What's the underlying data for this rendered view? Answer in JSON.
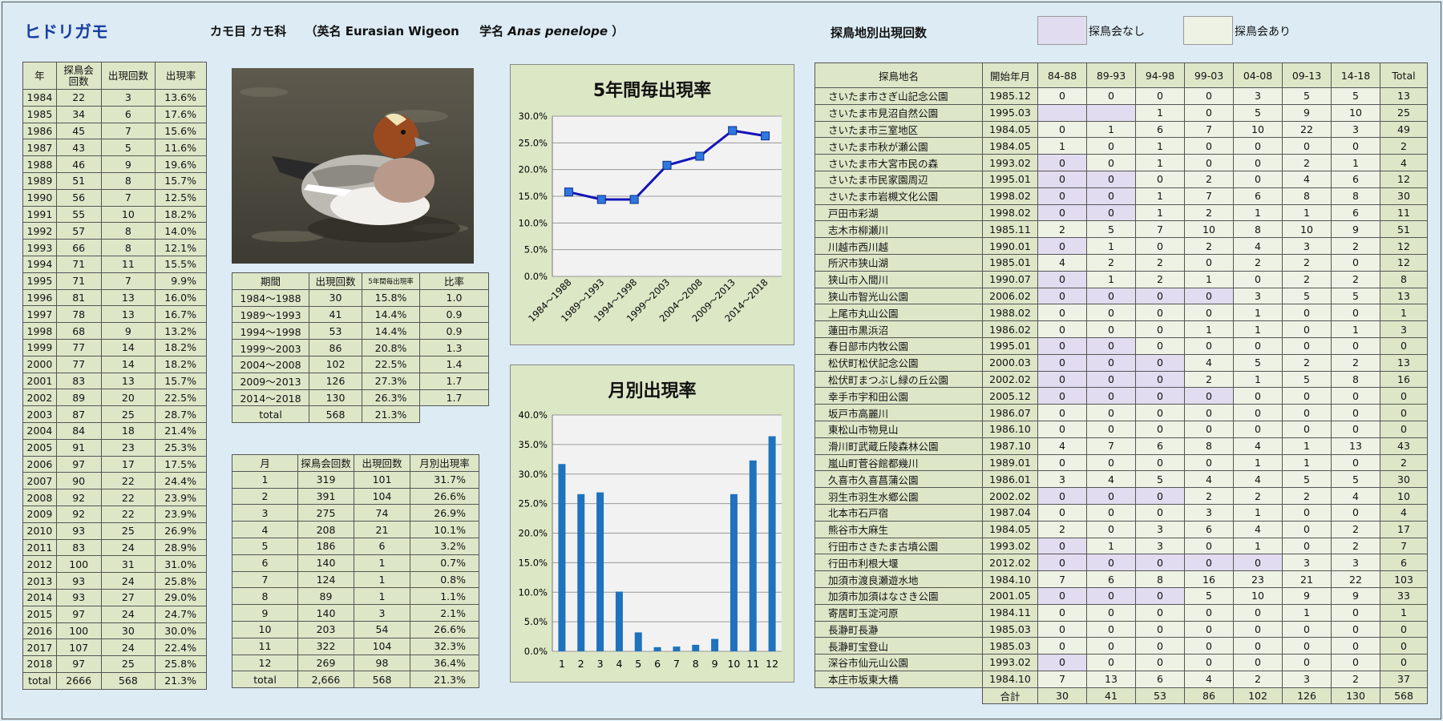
{
  "header": {
    "title": "ヒドリガモ",
    "taxonomy": "カモ目 カモ科",
    "english_label": "（英名",
    "english_name": "Eurasian Wigeon",
    "scientific_label": "学名",
    "scientific_name": "Anas penelope",
    "close_paren": "）",
    "sites_title": "探鳥地別出現回数",
    "legend_no_meeting": "探鳥会なし",
    "legend_with_meeting": "探鳥会あり"
  },
  "colors": {
    "no_meeting": "#e2dcf0",
    "with_meeting": "#eef2e4",
    "header_green": "#dde7c8",
    "line": "#1414b8",
    "bar": "#1f72bc"
  },
  "yearly": {
    "headers": [
      "年",
      "探鳥会回数",
      "出現回数",
      "出現率"
    ],
    "rows": [
      [
        "1984",
        "22",
        "3",
        "13.6%"
      ],
      [
        "1985",
        "34",
        "6",
        "17.6%"
      ],
      [
        "1986",
        "45",
        "7",
        "15.6%"
      ],
      [
        "1987",
        "43",
        "5",
        "11.6%"
      ],
      [
        "1988",
        "46",
        "9",
        "19.6%"
      ],
      [
        "1989",
        "51",
        "8",
        "15.7%"
      ],
      [
        "1990",
        "56",
        "7",
        "12.5%"
      ],
      [
        "1991",
        "55",
        "10",
        "18.2%"
      ],
      [
        "1992",
        "57",
        "8",
        "14.0%"
      ],
      [
        "1993",
        "66",
        "8",
        "12.1%"
      ],
      [
        "1994",
        "71",
        "11",
        "15.5%"
      ],
      [
        "1995",
        "71",
        "7",
        "9.9%"
      ],
      [
        "1996",
        "81",
        "13",
        "16.0%"
      ],
      [
        "1997",
        "78",
        "13",
        "16.7%"
      ],
      [
        "1998",
        "68",
        "9",
        "13.2%"
      ],
      [
        "1999",
        "77",
        "14",
        "18.2%"
      ],
      [
        "2000",
        "77",
        "14",
        "18.2%"
      ],
      [
        "2001",
        "83",
        "13",
        "15.7%"
      ],
      [
        "2002",
        "89",
        "20",
        "22.5%"
      ],
      [
        "2003",
        "87",
        "25",
        "28.7%"
      ],
      [
        "2004",
        "84",
        "18",
        "21.4%"
      ],
      [
        "2005",
        "91",
        "23",
        "25.3%"
      ],
      [
        "2006",
        "97",
        "17",
        "17.5%"
      ],
      [
        "2007",
        "90",
        "22",
        "24.4%"
      ],
      [
        "2008",
        "92",
        "22",
        "23.9%"
      ],
      [
        "2009",
        "92",
        "22",
        "23.9%"
      ],
      [
        "2010",
        "93",
        "25",
        "26.9%"
      ],
      [
        "2011",
        "83",
        "24",
        "28.9%"
      ],
      [
        "2012",
        "100",
        "31",
        "31.0%"
      ],
      [
        "2013",
        "93",
        "24",
        "25.8%"
      ],
      [
        "2014",
        "93",
        "27",
        "29.0%"
      ],
      [
        "2015",
        "97",
        "24",
        "24.7%"
      ],
      [
        "2016",
        "100",
        "30",
        "30.0%"
      ],
      [
        "2017",
        "107",
        "24",
        "22.4%"
      ],
      [
        "2018",
        "97",
        "25",
        "25.8%"
      ],
      [
        "total",
        "2666",
        "568",
        "21.3%"
      ]
    ]
  },
  "period": {
    "headers": [
      "期間",
      "出現回数",
      "5年間毎出現率",
      "比率"
    ],
    "rows": [
      [
        "1984～1988",
        "30",
        "15.8%",
        "1.0"
      ],
      [
        "1989～1993",
        "41",
        "14.4%",
        "0.9"
      ],
      [
        "1994～1998",
        "53",
        "14.4%",
        "0.9"
      ],
      [
        "1999～2003",
        "86",
        "20.8%",
        "1.3"
      ],
      [
        "2004～2008",
        "102",
        "22.5%",
        "1.4"
      ],
      [
        "2009～2013",
        "126",
        "27.3%",
        "1.7"
      ],
      [
        "2014～2018",
        "130",
        "26.3%",
        "1.7"
      ]
    ],
    "total": [
      "total",
      "568",
      "21.3%"
    ]
  },
  "monthly": {
    "headers": [
      "月",
      "探鳥会回数",
      "出現回数",
      "月別出現率"
    ],
    "rows": [
      [
        "1",
        "319",
        "101",
        "31.7%"
      ],
      [
        "2",
        "391",
        "104",
        "26.6%"
      ],
      [
        "3",
        "275",
        "74",
        "26.9%"
      ],
      [
        "4",
        "208",
        "21",
        "10.1%"
      ],
      [
        "5",
        "186",
        "6",
        "3.2%"
      ],
      [
        "6",
        "140",
        "1",
        "0.7%"
      ],
      [
        "7",
        "124",
        "1",
        "0.8%"
      ],
      [
        "8",
        "89",
        "1",
        "1.1%"
      ],
      [
        "9",
        "140",
        "3",
        "2.1%"
      ],
      [
        "10",
        "203",
        "54",
        "26.6%"
      ],
      [
        "11",
        "322",
        "104",
        "32.3%"
      ],
      [
        "12",
        "269",
        "98",
        "36.4%"
      ],
      [
        "total",
        "2,666",
        "568",
        "21.3%"
      ]
    ]
  },
  "chart_data": [
    {
      "type": "line",
      "title": "5年間毎出現率",
      "categories": [
        "1984～1988",
        "1989～1993",
        "1994～1998",
        "1999～2003",
        "2004～2008",
        "2009～2013",
        "2014～2018"
      ],
      "values": [
        15.8,
        14.4,
        14.4,
        20.8,
        22.5,
        27.3,
        26.3
      ],
      "y_ticks": [
        "0.0%",
        "5.0%",
        "10.0%",
        "15.0%",
        "20.0%",
        "25.0%",
        "30.0%"
      ],
      "ylim": [
        0,
        30
      ],
      "grid": true
    },
    {
      "type": "bar",
      "title": "月別出現率",
      "categories": [
        "1",
        "2",
        "3",
        "4",
        "5",
        "6",
        "7",
        "8",
        "9",
        "10",
        "11",
        "12"
      ],
      "values": [
        31.7,
        26.6,
        26.9,
        10.1,
        3.2,
        0.7,
        0.8,
        1.1,
        2.1,
        26.6,
        32.3,
        36.4
      ],
      "y_ticks": [
        "0.0%",
        "5.0%",
        "10.0%",
        "15.0%",
        "20.0%",
        "25.0%",
        "30.0%",
        "35.0%",
        "40.0%"
      ],
      "ylim": [
        0,
        40
      ],
      "grid": true
    }
  ],
  "sites": {
    "headers": [
      "探鳥地名",
      "開始年月",
      "84-88",
      "89-93",
      "94-98",
      "99-03",
      "04-08",
      "09-13",
      "14-18",
      "Total"
    ],
    "rows": [
      {
        "name": "さいたま市さぎ山記念公園",
        "start": "1985.12",
        "v": [
          "0",
          "0",
          "0",
          "0",
          "3",
          "5",
          "5",
          "13"
        ],
        "lav": []
      },
      {
        "name": "さいたま市見沼自然公園",
        "start": "1995.03",
        "v": [
          "",
          "",
          "1",
          "0",
          "5",
          "9",
          "10",
          "25"
        ],
        "lav": [
          0,
          1
        ]
      },
      {
        "name": "さいたま市三室地区",
        "start": "1984.05",
        "v": [
          "0",
          "1",
          "6",
          "7",
          "10",
          "22",
          "3",
          "49"
        ],
        "lav": []
      },
      {
        "name": "さいたま市秋が瀬公園",
        "start": "1984.05",
        "v": [
          "1",
          "0",
          "1",
          "0",
          "0",
          "0",
          "0",
          "2"
        ],
        "lav": []
      },
      {
        "name": "さいたま市大宮市民の森",
        "start": "1993.02",
        "v": [
          "0",
          "0",
          "1",
          "0",
          "0",
          "2",
          "1",
          "4"
        ],
        "lav": [
          0
        ]
      },
      {
        "name": "さいたま市民家園周辺",
        "start": "1995.01",
        "v": [
          "0",
          "0",
          "0",
          "2",
          "0",
          "4",
          "6",
          "12"
        ],
        "lav": [
          0,
          1
        ]
      },
      {
        "name": "さいたま市岩槻文化公園",
        "start": "1998.02",
        "v": [
          "0",
          "0",
          "1",
          "7",
          "6",
          "8",
          "8",
          "30"
        ],
        "lav": [
          0,
          1
        ]
      },
      {
        "name": "戸田市彩湖",
        "start": "1998.02",
        "v": [
          "0",
          "0",
          "1",
          "2",
          "1",
          "1",
          "6",
          "11"
        ],
        "lav": [
          0,
          1
        ]
      },
      {
        "name": "志木市柳瀬川",
        "start": "1985.11",
        "v": [
          "2",
          "5",
          "7",
          "10",
          "8",
          "10",
          "9",
          "51"
        ],
        "lav": []
      },
      {
        "name": "川越市西川越",
        "start": "1990.01",
        "v": [
          "0",
          "1",
          "0",
          "2",
          "4",
          "3",
          "2",
          "12"
        ],
        "lav": [
          0
        ]
      },
      {
        "name": "所沢市狭山湖",
        "start": "1985.01",
        "v": [
          "4",
          "2",
          "2",
          "0",
          "2",
          "2",
          "0",
          "12"
        ],
        "lav": []
      },
      {
        "name": "狭山市入間川",
        "start": "1990.07",
        "v": [
          "0",
          "1",
          "2",
          "1",
          "0",
          "2",
          "2",
          "8"
        ],
        "lav": [
          0
        ]
      },
      {
        "name": "狭山市智光山公園",
        "start": "2006.02",
        "v": [
          "0",
          "0",
          "0",
          "0",
          "3",
          "5",
          "5",
          "13"
        ],
        "lav": [
          0,
          1,
          2,
          3
        ]
      },
      {
        "name": "上尾市丸山公園",
        "start": "1988.02",
        "v": [
          "0",
          "0",
          "0",
          "0",
          "1",
          "0",
          "0",
          "1"
        ],
        "lav": []
      },
      {
        "name": "蓮田市黒浜沼",
        "start": "1986.02",
        "v": [
          "0",
          "0",
          "0",
          "1",
          "1",
          "0",
          "1",
          "3"
        ],
        "lav": []
      },
      {
        "name": "春日部市内牧公園",
        "start": "1995.01",
        "v": [
          "0",
          "0",
          "0",
          "0",
          "0",
          "0",
          "0",
          "0"
        ],
        "lav": [
          0,
          1
        ]
      },
      {
        "name": "松伏町松伏記念公園",
        "start": "2000.03",
        "v": [
          "0",
          "0",
          "0",
          "4",
          "5",
          "2",
          "2",
          "13"
        ],
        "lav": [
          0,
          1,
          2
        ]
      },
      {
        "name": "松伏町まつぶし緑の丘公園",
        "start": "2002.02",
        "v": [
          "0",
          "0",
          "0",
          "2",
          "1",
          "5",
          "8",
          "16"
        ],
        "lav": [
          0,
          1,
          2
        ]
      },
      {
        "name": "幸手市宇和田公園",
        "start": "2005.12",
        "v": [
          "0",
          "0",
          "0",
          "0",
          "0",
          "0",
          "0",
          "0"
        ],
        "lav": [
          0,
          1,
          2,
          3
        ]
      },
      {
        "name": "坂戸市高麗川",
        "start": "1986.07",
        "v": [
          "0",
          "0",
          "0",
          "0",
          "0",
          "0",
          "0",
          "0"
        ],
        "lav": []
      },
      {
        "name": "東松山市物見山",
        "start": "1986.10",
        "v": [
          "0",
          "0",
          "0",
          "0",
          "0",
          "0",
          "0",
          "0"
        ],
        "lav": []
      },
      {
        "name": "滑川町武蔵丘陵森林公園",
        "start": "1987.10",
        "v": [
          "4",
          "7",
          "6",
          "8",
          "4",
          "1",
          "13",
          "43"
        ],
        "lav": []
      },
      {
        "name": "嵐山町菅谷館都幾川",
        "start": "1989.01",
        "v": [
          "0",
          "0",
          "0",
          "0",
          "1",
          "1",
          "0",
          "2"
        ],
        "lav": []
      },
      {
        "name": "久喜市久喜菖蒲公園",
        "start": "1986.01",
        "v": [
          "3",
          "4",
          "5",
          "4",
          "4",
          "5",
          "5",
          "30"
        ],
        "lav": []
      },
      {
        "name": "羽生市羽生水郷公園",
        "start": "2002.02",
        "v": [
          "0",
          "0",
          "0",
          "2",
          "2",
          "2",
          "4",
          "10"
        ],
        "lav": [
          0,
          1,
          2
        ]
      },
      {
        "name": "北本市石戸宿",
        "start": "1987.04",
        "v": [
          "0",
          "0",
          "0",
          "3",
          "1",
          "0",
          "0",
          "4"
        ],
        "lav": []
      },
      {
        "name": "熊谷市大麻生",
        "start": "1984.05",
        "v": [
          "2",
          "0",
          "3",
          "6",
          "4",
          "0",
          "2",
          "17"
        ],
        "lav": []
      },
      {
        "name": "行田市さきたま古墳公園",
        "start": "1993.02",
        "v": [
          "0",
          "1",
          "3",
          "0",
          "1",
          "0",
          "2",
          "7"
        ],
        "lav": [
          0
        ]
      },
      {
        "name": "行田市利根大堰",
        "start": "2012.02",
        "v": [
          "0",
          "0",
          "0",
          "0",
          "0",
          "3",
          "3",
          "6"
        ],
        "lav": [
          0,
          1,
          2,
          3,
          4
        ]
      },
      {
        "name": "加須市渡良瀬遊水地",
        "start": "1984.10",
        "v": [
          "7",
          "6",
          "8",
          "16",
          "23",
          "21",
          "22",
          "103"
        ],
        "lav": []
      },
      {
        "name": "加須市加須はなさき公園",
        "start": "2001.05",
        "v": [
          "0",
          "0",
          "0",
          "5",
          "10",
          "9",
          "9",
          "33"
        ],
        "lav": [
          0,
          1,
          2
        ]
      },
      {
        "name": "寄居町玉淀河原",
        "start": "1984.11",
        "v": [
          "0",
          "0",
          "0",
          "0",
          "0",
          "1",
          "0",
          "1"
        ],
        "lav": []
      },
      {
        "name": "長瀞町長瀞",
        "start": "1985.03",
        "v": [
          "0",
          "0",
          "0",
          "0",
          "0",
          "0",
          "0",
          "0"
        ],
        "lav": []
      },
      {
        "name": "長瀞町宝登山",
        "start": "1985.03",
        "v": [
          "0",
          "0",
          "0",
          "0",
          "0",
          "0",
          "0",
          "0"
        ],
        "lav": []
      },
      {
        "name": "深谷市仙元山公園",
        "start": "1993.02",
        "v": [
          "0",
          "0",
          "0",
          "0",
          "0",
          "0",
          "0",
          "0"
        ],
        "lav": [
          0
        ]
      },
      {
        "name": "本庄市坂東大橋",
        "start": "1984.10",
        "v": [
          "7",
          "13",
          "6",
          "4",
          "2",
          "3",
          "2",
          "37"
        ],
        "lav": []
      }
    ],
    "total_label": "合計",
    "totals": [
      "30",
      "41",
      "53",
      "86",
      "102",
      "126",
      "130",
      "568"
    ]
  }
}
